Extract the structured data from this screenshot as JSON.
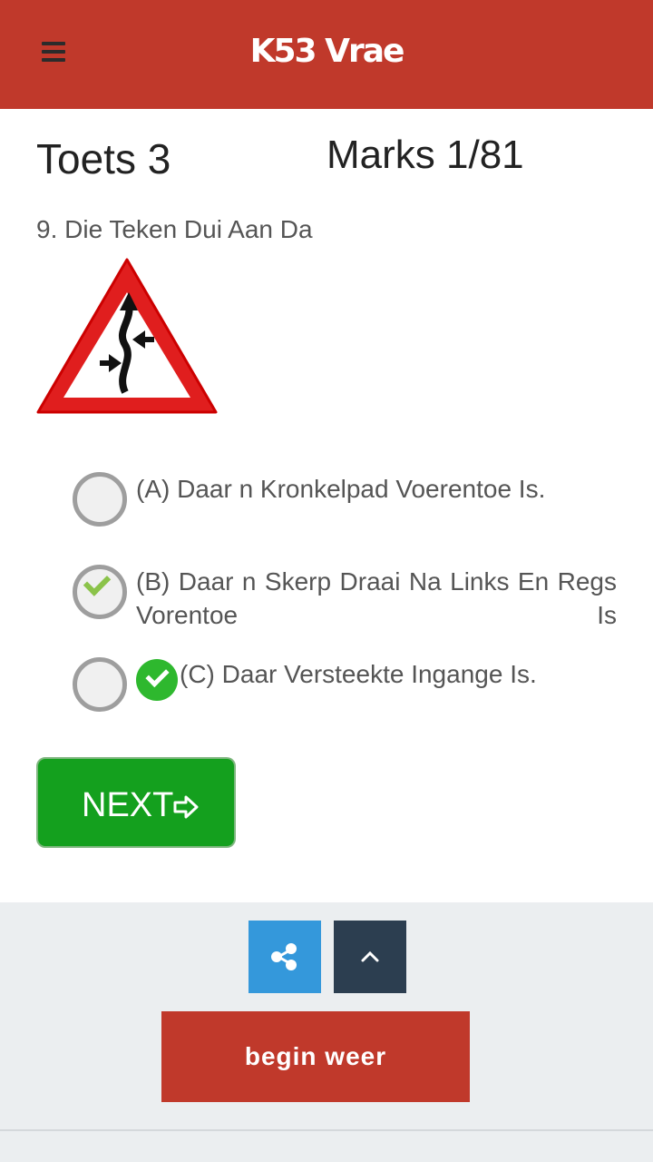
{
  "app": {
    "title": "K53 Vrae"
  },
  "quiz": {
    "name": "Toets 3",
    "marks": "Marks 1/81"
  },
  "question": {
    "text": "9. Die Teken Dui Aan Da"
  },
  "options": [
    {
      "label": "(A) Daar n Kronkelpad Voerentoe Is.",
      "selected": false,
      "correct": false
    },
    {
      "label": "(B) Daar n Skerp Draai Na Links En Regs Vorentoe Is",
      "selected": true,
      "correct": false
    },
    {
      "label": "(C) Daar Versteekte Ingange Is.",
      "selected": false,
      "correct": true
    }
  ],
  "buttons": {
    "next": "NEXT",
    "begin_again": "begin weer"
  },
  "colors": {
    "header": "#c0392b",
    "next": "#14a01e",
    "share": "#3498db",
    "scroll_top": "#2c3e50",
    "restart": "#c0392b"
  },
  "icons": {
    "menu": "hamburger-icon",
    "share": "share-icon",
    "up": "chevron-up-icon",
    "next": "arrow-right-icon",
    "correct": "check-circle-icon"
  }
}
